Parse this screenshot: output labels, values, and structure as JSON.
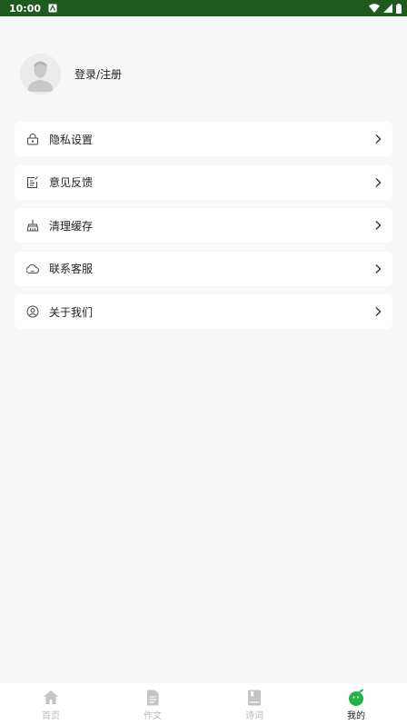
{
  "status_bar": {
    "time": "10:00"
  },
  "profile": {
    "login_label": "登录/注册"
  },
  "menu": [
    {
      "label": "隐私设置",
      "icon": "lock-icon"
    },
    {
      "label": "意见反馈",
      "icon": "feedback-icon"
    },
    {
      "label": "清理缓存",
      "icon": "broom-icon"
    },
    {
      "label": "联系客服",
      "icon": "chat-icon"
    },
    {
      "label": "关于我们",
      "icon": "user-circle-icon"
    }
  ],
  "tabbar": {
    "tabs": [
      {
        "label": "首页",
        "icon": "home-icon"
      },
      {
        "label": "作文",
        "icon": "document-icon"
      },
      {
        "label": "诗词",
        "icon": "book-icon"
      },
      {
        "label": "我的",
        "icon": "profile-icon"
      }
    ],
    "active_index": 3
  },
  "colors": {
    "status_bar": "#1f5b1e",
    "accent": "#24b24a",
    "background": "#f7f7f7",
    "inactive": "#b9b9b9"
  }
}
